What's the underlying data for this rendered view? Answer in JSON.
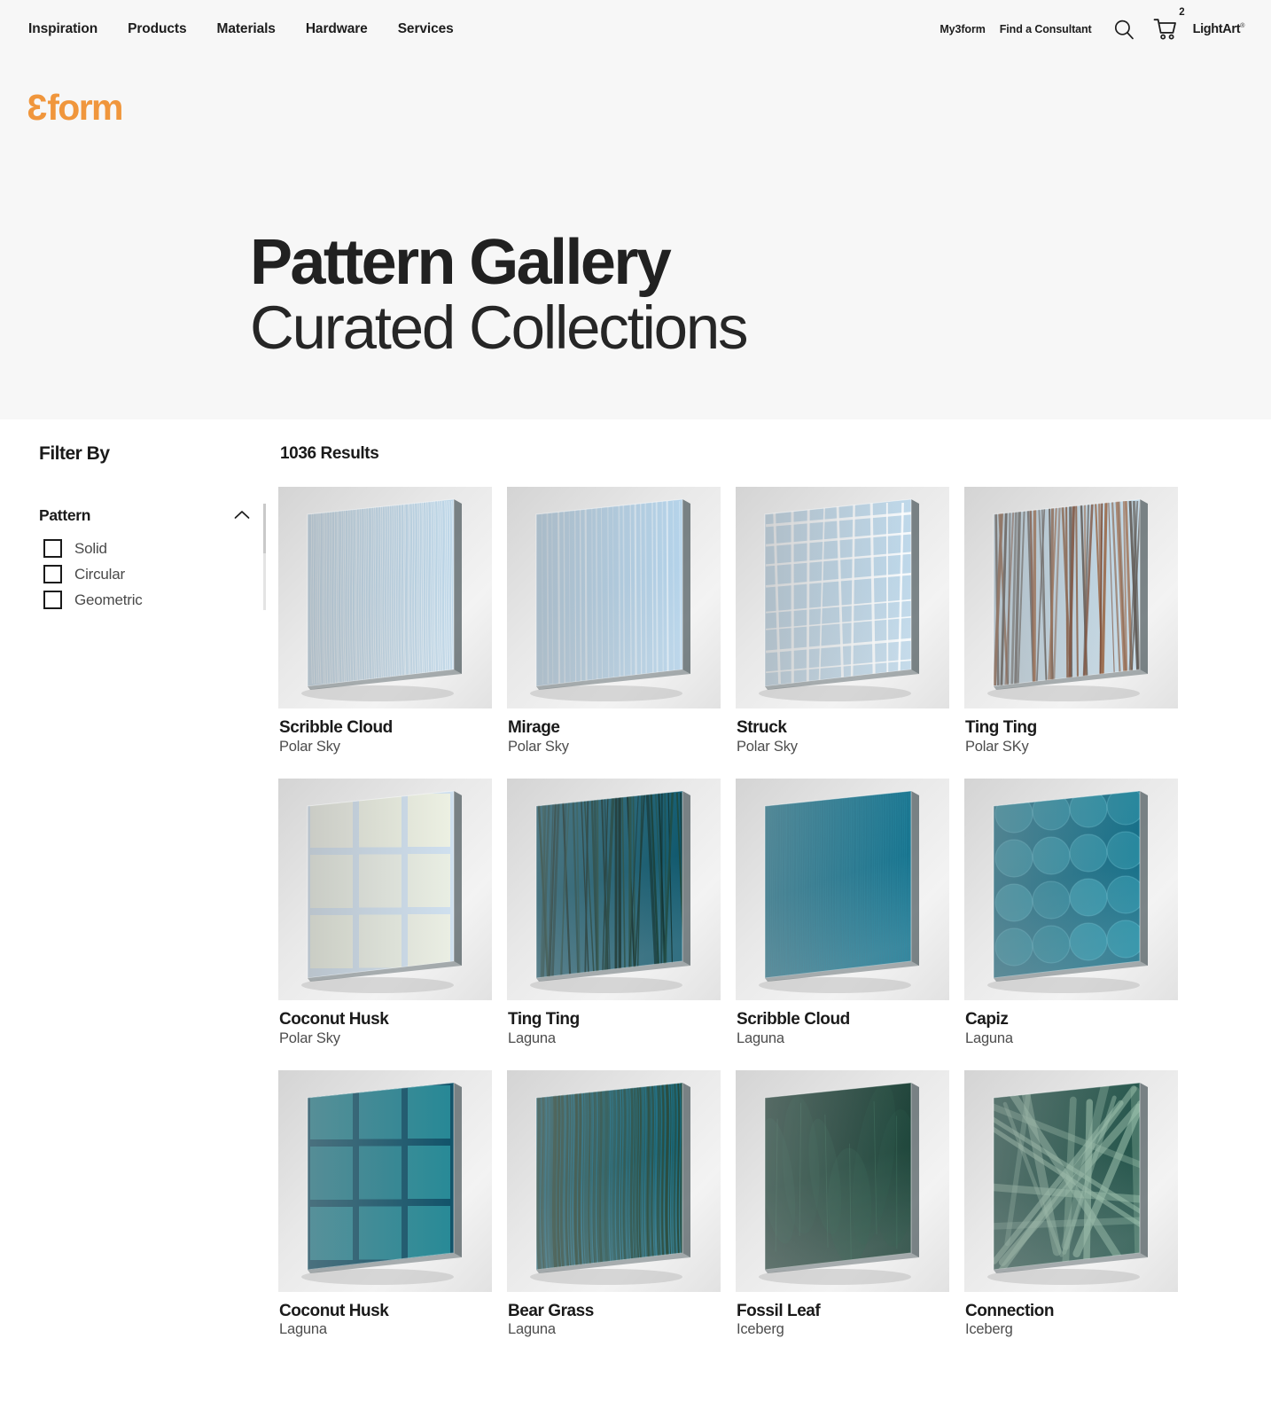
{
  "nav": {
    "primary": [
      {
        "label": "Inspiration",
        "name": "nav-inspiration"
      },
      {
        "label": "Products",
        "name": "nav-products"
      },
      {
        "label": "Materials",
        "name": "nav-materials"
      },
      {
        "label": "Hardware",
        "name": "nav-hardware"
      },
      {
        "label": "Services",
        "name": "nav-services"
      }
    ],
    "utility": {
      "my3form": "My3form",
      "find_consultant": "Find a Consultant",
      "search_icon": "search-icon",
      "cart_icon": "cart-icon",
      "cart_count": "2",
      "lightart": "LightArt"
    }
  },
  "brand": {
    "logo_text": "3form",
    "logo_color": "#f0963c"
  },
  "hero": {
    "title": "Pattern Gallery",
    "subtitle": "Curated Collections",
    "background": "#f7f7f7"
  },
  "sidebar": {
    "heading": "Filter By",
    "groups": [
      {
        "name": "Pattern",
        "collapse_icon": "chevron-up-icon",
        "expanded": true,
        "options": [
          {
            "label": "Solid",
            "checked": false
          },
          {
            "label": "Circular",
            "checked": false
          },
          {
            "label": "Geometric",
            "checked": false
          }
        ]
      }
    ]
  },
  "results": {
    "count_label": "1036 Results",
    "items": [
      {
        "name": "Scribble Cloud",
        "color": "Polar Sky",
        "swatch": "#bcd6e8",
        "pattern": "scribble"
      },
      {
        "name": "Mirage",
        "color": "Polar Sky",
        "swatch": "#b4d3ea",
        "pattern": "mirage"
      },
      {
        "name": "Struck",
        "color": "Polar Sky",
        "swatch": "#bed8ea",
        "pattern": "struck"
      },
      {
        "name": "Ting Ting",
        "color": "Polar SKy",
        "swatch": "#c4dbe9",
        "pattern": "tingting-light"
      },
      {
        "name": "Coconut Husk",
        "color": "Polar Sky",
        "swatch": "#e8ecdf",
        "pattern": "coconut-light"
      },
      {
        "name": "Ting Ting",
        "color": "Laguna",
        "swatch": "#10596e",
        "pattern": "tingting-dark"
      },
      {
        "name": "Scribble Cloud",
        "color": "Laguna",
        "swatch": "#17748f",
        "pattern": "scribble-dark"
      },
      {
        "name": "Capiz",
        "color": "Laguna",
        "swatch": "#156f88",
        "pattern": "capiz"
      },
      {
        "name": "Coconut Husk",
        "color": "Laguna",
        "swatch": "#1b7f92",
        "pattern": "coconut-dark"
      },
      {
        "name": "Bear Grass",
        "color": "Laguna",
        "swatch": "#15697e",
        "pattern": "beargrass"
      },
      {
        "name": "Fossil Leaf",
        "color": "Iceberg",
        "swatch": "#1d4238",
        "pattern": "fossilleaf"
      },
      {
        "name": "Connection",
        "color": "Iceberg",
        "swatch": "#23544a",
        "pattern": "connection"
      }
    ]
  }
}
